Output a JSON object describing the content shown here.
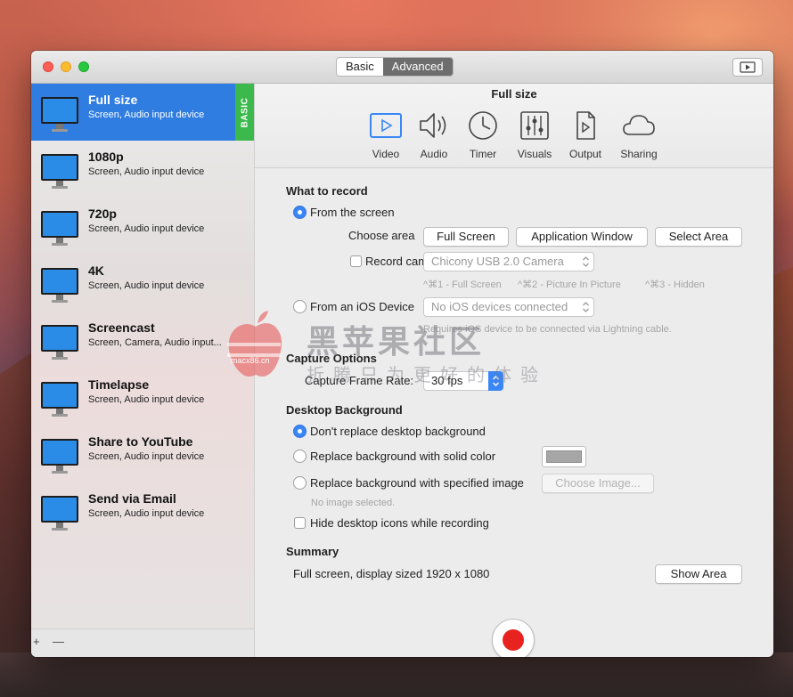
{
  "window": {
    "mode_tabs": [
      {
        "label": "Basic",
        "active": false
      },
      {
        "label": "Advanced",
        "active": true
      }
    ]
  },
  "sidebar": {
    "badge": "BASIC",
    "items": [
      {
        "title": "Full size",
        "subtitle": "Screen, Audio input device",
        "selected": true
      },
      {
        "title": "1080p",
        "subtitle": "Screen, Audio input device",
        "selected": false
      },
      {
        "title": "720p",
        "subtitle": "Screen, Audio input device",
        "selected": false
      },
      {
        "title": "4K",
        "subtitle": "Screen, Audio input device",
        "selected": false
      },
      {
        "title": "Screencast",
        "subtitle": "Screen, Camera, Audio input...",
        "selected": false
      },
      {
        "title": "Timelapse",
        "subtitle": "Screen, Audio input device",
        "selected": false
      },
      {
        "title": "Share to YouTube",
        "subtitle": "Screen, Audio input device",
        "selected": false
      },
      {
        "title": "Send via Email",
        "subtitle": "Screen, Audio input device",
        "selected": false
      }
    ],
    "bottom_controls": [
      "+",
      "—"
    ]
  },
  "panel": {
    "title": "Full size",
    "tools": [
      {
        "label": "Video",
        "icon": "video-icon",
        "active": true
      },
      {
        "label": "Audio",
        "icon": "speaker-icon",
        "active": false
      },
      {
        "label": "Timer",
        "icon": "clock-icon",
        "active": false
      },
      {
        "label": "Visuals",
        "icon": "sliders-icon",
        "active": false
      },
      {
        "label": "Output",
        "icon": "file-icon",
        "active": false
      },
      {
        "label": "Sharing",
        "icon": "cloud-icon",
        "active": false
      }
    ]
  },
  "what_to_record": {
    "heading": "What to record",
    "from_screen_label": "From the screen",
    "from_screen_selected": true,
    "choose_area_label": "Choose area",
    "area_buttons": [
      "Full Screen",
      "Application Window",
      "Select Area"
    ],
    "record_camera_label": "Record camera",
    "record_camera_checked": false,
    "camera_value": "Chicony USB 2.0 Camera",
    "camera_hints": [
      "^⌘1 - Full Screen",
      "^⌘2 - Picture In Picture",
      "^⌘3 - Hidden"
    ],
    "from_ios_label": "From an iOS Device",
    "from_ios_selected": false,
    "ios_value": "No iOS devices connected",
    "ios_hint": "Requires iOS device to be connected via Lightning cable."
  },
  "capture_options": {
    "heading": "Capture Options",
    "frame_rate_label": "Capture Frame Rate:",
    "frame_rate_value": "30 fps"
  },
  "desktop_background": {
    "heading": "Desktop Background",
    "options": [
      {
        "label": "Don't replace desktop background",
        "selected": true
      },
      {
        "label": "Replace background with solid color",
        "selected": false
      },
      {
        "label": "Replace background with specified image",
        "selected": false
      }
    ],
    "solid_color": "#a6a6a6",
    "choose_image_label": "Choose Image...",
    "no_image_text": "No image selected.",
    "hide_icons_label": "Hide desktop icons while recording",
    "hide_icons_checked": false
  },
  "summary": {
    "heading": "Summary",
    "text": "Full screen, display sized 1920 x 1080",
    "show_area_label": "Show Area"
  },
  "watermark": {
    "site": "macx86.cn",
    "title": "黑苹果社区",
    "subtitle": "折腾只为更好的体验"
  },
  "colors": {
    "accent": "#2f7de1",
    "badge": "#3cb94c",
    "record": "#e8231f"
  }
}
